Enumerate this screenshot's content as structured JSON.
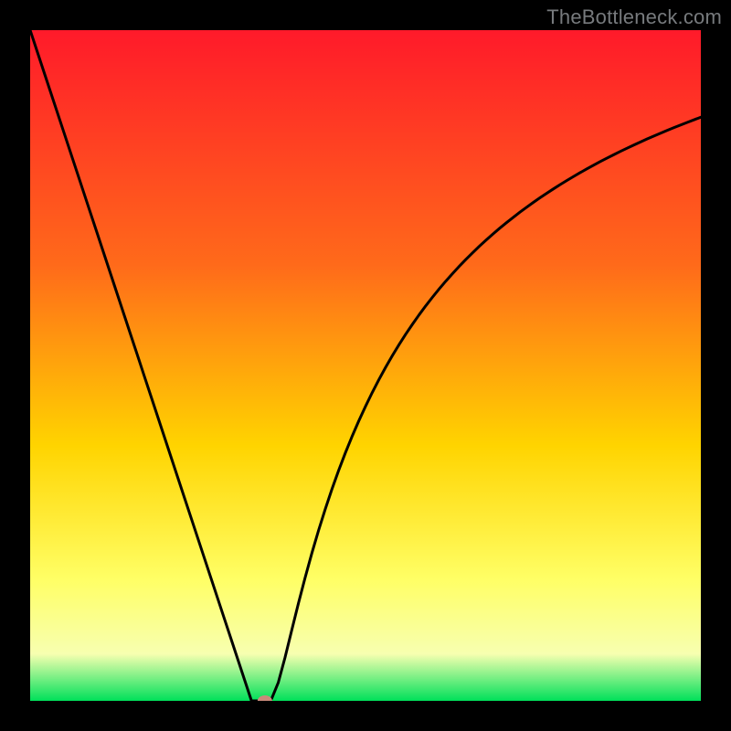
{
  "watermark": "TheBottleneck.com",
  "colors": {
    "gradient_top": "#ff1a2a",
    "gradient_mid1": "#ff6a1a",
    "gradient_mid2": "#ffd400",
    "gradient_mid3": "#ffff66",
    "gradient_mid4": "#f7ffb0",
    "gradient_bottom": "#00e05a",
    "curve": "#000000",
    "marker": "#c98a7a",
    "frame": "#000000"
  },
  "chart_data": {
    "type": "line",
    "title": "",
    "xlabel": "",
    "ylabel": "",
    "xlim": [
      0,
      100
    ],
    "ylim": [
      0,
      100
    ],
    "x": [
      0,
      1,
      2,
      3,
      4,
      5,
      6,
      7,
      8,
      9,
      10,
      11,
      12,
      13,
      14,
      15,
      16,
      17,
      18,
      19,
      20,
      21,
      22,
      23,
      24,
      25,
      26,
      27,
      28,
      29,
      30,
      31,
      32,
      33,
      34,
      35,
      36,
      37,
      38,
      39,
      40,
      41,
      42,
      43,
      44,
      45,
      46,
      47,
      48,
      49,
      50,
      51,
      52,
      53,
      54,
      55,
      56,
      57,
      58,
      59,
      60,
      61,
      62,
      63,
      64,
      65,
      66,
      67,
      68,
      69,
      70,
      71,
      72,
      73,
      74,
      75,
      76,
      77,
      78,
      79,
      80,
      81,
      82,
      83,
      84,
      85,
      86,
      87,
      88,
      89,
      90,
      91,
      92,
      93,
      94,
      95,
      96,
      97,
      98,
      99,
      100
    ],
    "values": [
      100.0,
      96.97,
      93.94,
      90.91,
      87.88,
      84.85,
      81.82,
      78.79,
      75.76,
      72.73,
      69.7,
      66.67,
      63.64,
      60.61,
      57.58,
      54.55,
      51.52,
      48.48,
      45.45,
      42.42,
      39.39,
      36.36,
      33.33,
      30.3,
      27.27,
      24.24,
      21.21,
      18.18,
      15.15,
      12.12,
      9.09,
      6.06,
      3.03,
      0.0,
      0.0,
      0.0,
      0.3,
      2.74,
      6.45,
      10.52,
      14.54,
      18.38,
      22.01,
      25.41,
      28.59,
      31.57,
      34.36,
      36.98,
      39.43,
      41.74,
      43.91,
      45.96,
      47.9,
      49.73,
      51.46,
      53.11,
      54.67,
      56.15,
      57.57,
      58.92,
      60.2,
      61.43,
      62.61,
      63.73,
      64.81,
      65.85,
      66.84,
      67.8,
      68.72,
      69.6,
      70.46,
      71.28,
      72.07,
      72.84,
      73.58,
      74.3,
      75.0,
      75.67,
      76.32,
      76.96,
      77.57,
      78.17,
      78.75,
      79.31,
      79.86,
      80.4,
      80.92,
      81.42,
      81.92,
      82.4,
      82.87,
      83.33,
      83.78,
      84.21,
      84.64,
      85.06,
      85.47,
      85.87,
      86.26,
      86.64,
      87.02
    ],
    "marker": {
      "x": 35,
      "y": 0
    },
    "annotations": []
  }
}
